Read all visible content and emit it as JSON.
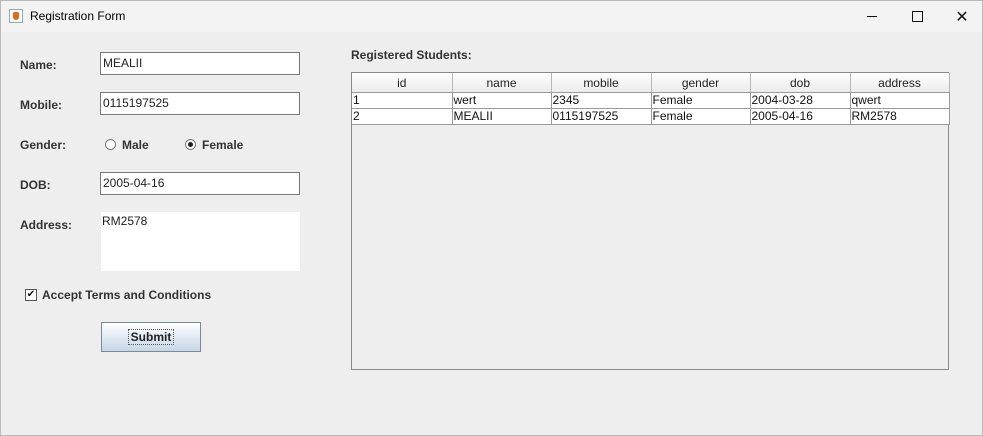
{
  "window": {
    "title": "Registration Form"
  },
  "form": {
    "name_label": "Name:",
    "name_value": "MEALII",
    "mobile_label": "Mobile:",
    "mobile_value": "0115197525",
    "gender_label": "Gender:",
    "gender_options": [
      "Male",
      "Female"
    ],
    "gender_selected": "Female",
    "dob_label": "DOB:",
    "dob_value": "2005-04-16",
    "address_label": "Address:",
    "address_value": "RM2578",
    "terms_label": "Accept Terms and Conditions",
    "terms_checked": true,
    "submit_label": "Submit"
  },
  "table": {
    "title": "Registered Students:",
    "columns": [
      "id",
      "name",
      "mobile",
      "gender",
      "dob",
      "address"
    ],
    "rows": [
      [
        "1",
        "wert",
        "2345",
        "Female",
        "2004-03-28",
        "qwert"
      ],
      [
        "2",
        "MEALII",
        "0115197525",
        "Female",
        "2005-04-16",
        "RM2578"
      ]
    ]
  }
}
